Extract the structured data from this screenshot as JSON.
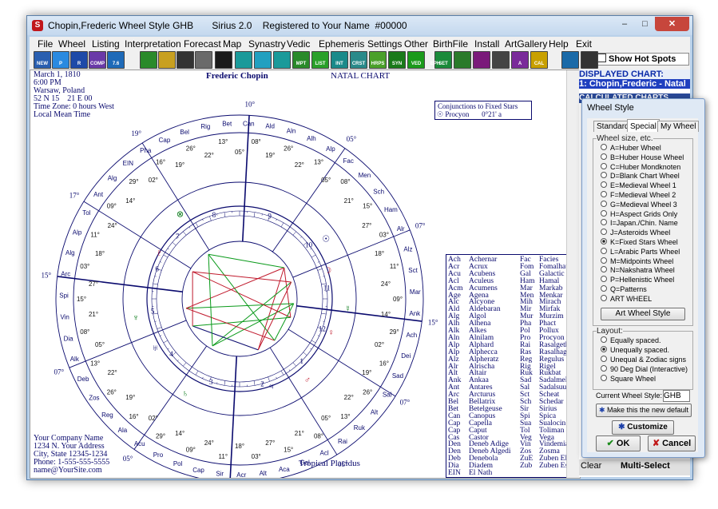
{
  "window": {
    "title": "Chopin,Frederic Wheel Style GHB       Sirius 2.0    Registered to Your Name  #00000",
    "controls": {
      "minimize": "–",
      "maximize": "□",
      "close": "✕"
    }
  },
  "menu": [
    "File",
    "Wheel",
    "Listing",
    "Interpretation",
    "Forecast",
    "Map",
    "Synastry",
    "Vedic",
    "Ephemeris",
    "Settings",
    "Other",
    "BirthFile",
    "Install",
    "ArtGallery",
    "Help",
    "Exit"
  ],
  "toolbar": {
    "left_labels": [
      "NEW",
      "P",
      "R",
      "COMP",
      "7.6"
    ],
    "right_labels": [
      "MPT",
      "LIST",
      "INT",
      "CRST",
      "HRPS",
      "SYN",
      "VED",
      "EPH",
      "SET",
      "A",
      "CAL"
    ],
    "show_hot_spots": "Show Hot Spots"
  },
  "chart": {
    "birth_info": [
      "March 1, 1810",
      "6:00 PM",
      "Warsaw, Poland",
      "52 N 15    21 E 00",
      "Time Zone: 0 hours West",
      "Local Mean Time"
    ],
    "name": "Frederic Chopin",
    "chart_type": "NATAL CHART",
    "house_system": "Tropical Placidus",
    "company": [
      "Your Company Name",
      "1234 N. Your Address",
      "City, State 12345-1234",
      "Phone: 1-555-555-5555",
      "name@YourSite.com"
    ],
    "conjunctions_title": "Conjunctions to Fixed Stars",
    "conjunction_row": {
      "glyph": "☉",
      "star": "Procyon",
      "orb": "0°21' a"
    },
    "house_numbers": [
      "9",
      "10",
      "11",
      "12",
      "1",
      "2",
      "3",
      "4",
      "5",
      "6",
      "7",
      "8"
    ],
    "cusps": [
      {
        "deg": "10°",
        "sign": "♈",
        "min": "26'"
      },
      {
        "deg": "05°",
        "sign": "♊",
        "min": "12'"
      },
      {
        "deg": "07°",
        "sign": "♋",
        "min": "00'"
      },
      {
        "deg": "15°",
        "sign": "♌",
        "min": "13'"
      },
      {
        "deg": "07°",
        "sign": "♍",
        "min": "00'"
      },
      {
        "deg": "05°",
        "sign": "♐",
        "min": "12'"
      },
      {
        "deg": "10°",
        "sign": "♎",
        "min": "26'"
      },
      {
        "deg": "05°",
        "sign": "♏",
        "min": "12'"
      },
      {
        "deg": "07°",
        "sign": "♑",
        "min": "00'"
      },
      {
        "deg": "15°",
        "sign": "♒",
        "min": "13'"
      },
      {
        "deg": "17°",
        "sign": "♓",
        "min": "48'"
      },
      {
        "deg": "19°",
        "sign": "♉",
        "min": "57'"
      }
    ],
    "stars_outer": [
      "Ald",
      "Aln",
      "Alh",
      "Alp",
      "Fac",
      "Men",
      "Sch",
      "Ham",
      "Alr",
      "Alz",
      "Sct",
      "Mar",
      "Ank",
      "Ach",
      "Dei",
      "Sad",
      "Sal",
      "Alt",
      "Ruk",
      "Rai",
      "Acl",
      "Gal",
      "Aca",
      "Alt",
      "Acr",
      "Sir",
      "Cap",
      "Pol",
      "Pro",
      "Acu",
      "Ala",
      "Reg",
      "Zos",
      "Deb",
      "Alk",
      "Dia",
      "Vin",
      "Spi",
      "Arc",
      "Alg",
      "Alp",
      "Tol",
      "Ant",
      "Alg",
      "EIN",
      "Pha",
      "Cap",
      "Bel",
      "Rig",
      "Bet",
      "Can"
    ],
    "planets": [
      {
        "glyph": "☉",
        "color": "#0a0a6e"
      },
      {
        "glyph": "☽",
        "color": "#c0192c"
      },
      {
        "glyph": "☿",
        "color": "#0a7a1a"
      },
      {
        "glyph": "♀",
        "color": "#c0192c"
      },
      {
        "glyph": "♂",
        "color": "#c0192c"
      },
      {
        "glyph": "♃",
        "color": "#0a0a6e"
      },
      {
        "glyph": "♄",
        "color": "#0a7a1a"
      },
      {
        "glyph": "♅",
        "color": "#0a0a6e"
      },
      {
        "glyph": "♆",
        "color": "#0a7a1a"
      },
      {
        "glyph": "♇",
        "color": "#c0192c"
      },
      {
        "glyph": "⊗",
        "color": "#0a7a1a"
      }
    ]
  },
  "fixed_stars_legend": [
    [
      "Ach",
      "Achernar",
      "Fac",
      "Facies"
    ],
    [
      "Acr",
      "Acrux",
      "Fom",
      "Fomalhaut"
    ],
    [
      "Acu",
      "Acubens",
      "Gal",
      "Galactic Cen"
    ],
    [
      "Acl",
      "Aculeus",
      "Ham",
      "Hamal"
    ],
    [
      "Acm",
      "Acumens",
      "Mar",
      "Markab"
    ],
    [
      "Age",
      "Agena",
      "Men",
      "Menkar"
    ],
    [
      "Alc",
      "Alcyone",
      "Mih",
      "Mirach"
    ],
    [
      "Ald",
      "Aldebaran",
      "Mir",
      "Mirfak"
    ],
    [
      "Alg",
      "Algol",
      "Mur",
      "Murzim"
    ],
    [
      "Alh",
      "Alhena",
      "Pha",
      "Phact"
    ],
    [
      "Alk",
      "Alkes",
      "Pol",
      "Pollux"
    ],
    [
      "Aln",
      "Alnilam",
      "Pro",
      "Procyon"
    ],
    [
      "Alp",
      "Alphard",
      "Rai",
      "Rasalgethi"
    ],
    [
      "Alp",
      "Alphecca",
      "Ras",
      "Rasalhague"
    ],
    [
      "Alz",
      "Alpheratz",
      "Reg",
      "Regulus"
    ],
    [
      "Alr",
      "Alrischa",
      "Rig",
      "Rigel"
    ],
    [
      "Alt",
      "Altair",
      "Ruk",
      "Rukbat"
    ],
    [
      "Ank",
      "Ankaa",
      "Sad",
      "Sadalmelik"
    ],
    [
      "Ant",
      "Antares",
      "Sal",
      "Sadalsuud"
    ],
    [
      "Arc",
      "Arcturus",
      "Sct",
      "Scheat"
    ],
    [
      "Bel",
      "Bellatrix",
      "Sch",
      "Schedar"
    ],
    [
      "Bet",
      "Betelgeuse",
      "Sir",
      "Sirius"
    ],
    [
      "Can",
      "Canopus",
      "Spi",
      "Spica"
    ],
    [
      "Cap",
      "Capella",
      "Sua",
      "Sualocin"
    ],
    [
      "Cap",
      "Caput",
      "Tol",
      "Toliman"
    ],
    [
      "Cas",
      "Castor",
      "Veg",
      "Vega"
    ],
    [
      "Den",
      "Deneb Adige",
      "Vin",
      "Vindemiatrix"
    ],
    [
      "Den",
      "Deneb Algedi",
      "Zos",
      "Zosma"
    ],
    [
      "Deb",
      "Denebola",
      "ZuE",
      "Zuben Elgenu"
    ],
    [
      "Dia",
      "Diadem",
      "Zub",
      "Zuben Eschem"
    ],
    [
      "EIN",
      "El Nath",
      "",
      ""
    ]
  ],
  "right_panel": {
    "displayed_label": "DISPLAYED CHART:",
    "displayed_value": "1: Chopin,Frederic - Natal",
    "calculated_label": "CALCULATED CHARTS",
    "clear": "Clear",
    "multi_select": "Multi-Select"
  },
  "dialog": {
    "title": "Wheel Style",
    "tabs": [
      "Standard",
      "Special",
      "My Wheel"
    ],
    "active_tab": "Special",
    "group_wheel_size": "Wheel size, etc.",
    "wheel_options": [
      "A=Huber Wheel",
      "B=Huber House Wheel",
      "C=Huber Mondknoten",
      "D=Blank Chart Wheel",
      "E=Medieval Wheel 1",
      "F=Medieval Wheel 2",
      "G=Medieval Wheel 3",
      "H=Aspect Grids Only",
      "I=Japan./Chin. Name",
      "J=Asteroids Wheel",
      "K=Fixed Stars Wheel",
      "L=Arabic Parts Wheel",
      "M=Midpoints Wheel",
      "N=Nakshatra Wheel",
      "P=Hellenistic Wheel",
      "Q=Patterns",
      "ART WHEEL"
    ],
    "selected_wheel": "K=Fixed Stars Wheel",
    "art_button": "Art Wheel Style",
    "group_layout": "Layout:",
    "layout_options": [
      "Equally spaced.",
      "Unequally spaced.",
      "Unequal & Zodiac signs",
      "90 Deg Dial (Interactive)",
      "Square Wheel"
    ],
    "selected_layout": "Unequally spaced.",
    "current_style_label": "Current Wheel Style:",
    "current_style_value": "GHB",
    "default_button": "Make this the new default",
    "customize_button": "Customize",
    "ok_button": "OK",
    "cancel_button": "Cancel"
  }
}
